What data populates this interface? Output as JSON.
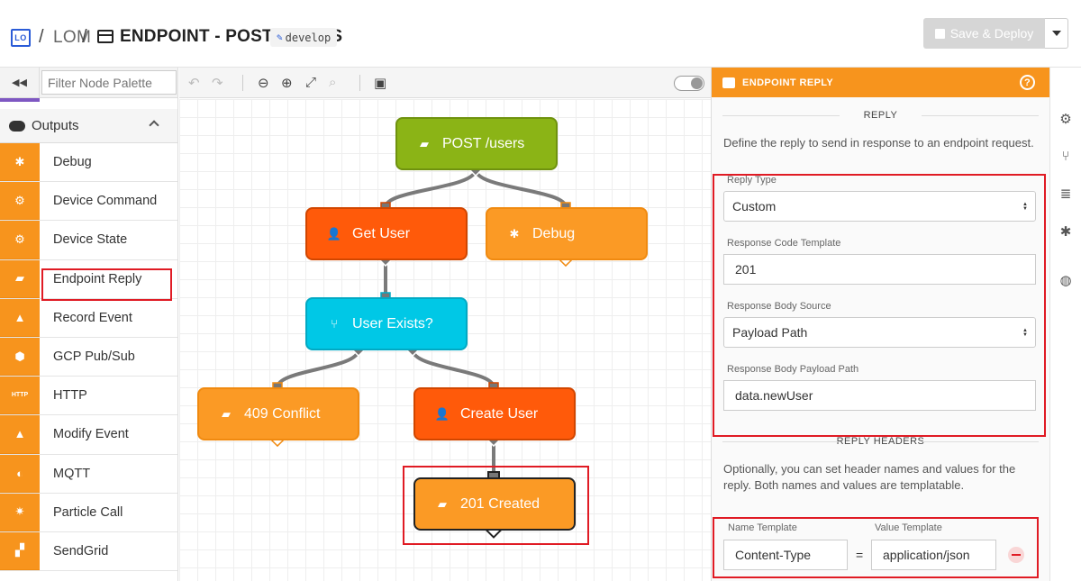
{
  "header": {
    "logo_text": "LO",
    "separator": "/",
    "app_name": "LOM",
    "flow_title": "ENDPOINT - POST /USERS",
    "branch": "develop",
    "save_label": "Save & Deploy"
  },
  "palette": {
    "filter_placeholder": "Filter Node Palette",
    "section_label": "Outputs",
    "items": [
      {
        "label": "Debug",
        "icon": "bug-icon",
        "glyph": "✱"
      },
      {
        "label": "Device Command",
        "icon": "chip-icon",
        "glyph": "⚙"
      },
      {
        "label": "Device State",
        "icon": "chip-gear-icon",
        "glyph": "⚙"
      },
      {
        "label": "Endpoint Reply",
        "icon": "endpoint-reply-icon",
        "glyph": "▰"
      },
      {
        "label": "Record Event",
        "icon": "record-event-icon",
        "glyph": "▲"
      },
      {
        "label": "GCP Pub/Sub",
        "icon": "gcp-icon",
        "glyph": "⬢"
      },
      {
        "label": "HTTP",
        "icon": "http-icon",
        "glyph": "HTTP"
      },
      {
        "label": "Modify Event",
        "icon": "modify-event-icon",
        "glyph": "▲"
      },
      {
        "label": "MQTT",
        "icon": "mqtt-icon",
        "glyph": "◐"
      },
      {
        "label": "Particle Call",
        "icon": "particle-icon",
        "glyph": "✷"
      },
      {
        "label": "SendGrid",
        "icon": "sendgrid-icon",
        "glyph": "▞"
      }
    ]
  },
  "canvas": {
    "nodes": [
      {
        "id": "post-users",
        "label": "POST /users",
        "color": "#8bb416"
      },
      {
        "id": "get-user",
        "label": "Get User",
        "color": "#ff5a0a"
      },
      {
        "id": "debug",
        "label": "Debug",
        "color": "#fb9a25"
      },
      {
        "id": "user-exists",
        "label": "User Exists?",
        "color": "#00c8e6"
      },
      {
        "id": "conflict",
        "label": "409 Conflict",
        "color": "#fb9a25"
      },
      {
        "id": "create-user",
        "label": "Create User",
        "color": "#ff5a0a"
      },
      {
        "id": "created",
        "label": "201 Created",
        "color": "#fb9a25"
      }
    ]
  },
  "panel": {
    "title": "ENDPOINT REPLY",
    "reply_section": "REPLY",
    "reply_description": "Define the reply to send in response to an endpoint request.",
    "reply_type_label": "Reply Type",
    "reply_type_value": "Custom",
    "response_code_label": "Response Code Template",
    "response_code_value": "201",
    "body_source_label": "Response Body Source",
    "body_source_value": "Payload Path",
    "body_path_label": "Response Body Payload Path",
    "body_path_value": "data.newUser",
    "headers_section": "REPLY HEADERS",
    "headers_description": "Optionally, you can set header names and values for the reply. Both names and values are templatable.",
    "name_template_label": "Name Template",
    "value_template_label": "Value Template",
    "header_name": "Content-Type",
    "equals": "=",
    "header_value": "application/json"
  },
  "colors": {
    "accent_orange": "#f7941d",
    "highlight_red": "#e01b24",
    "brand_blue": "#2a5bd7"
  }
}
